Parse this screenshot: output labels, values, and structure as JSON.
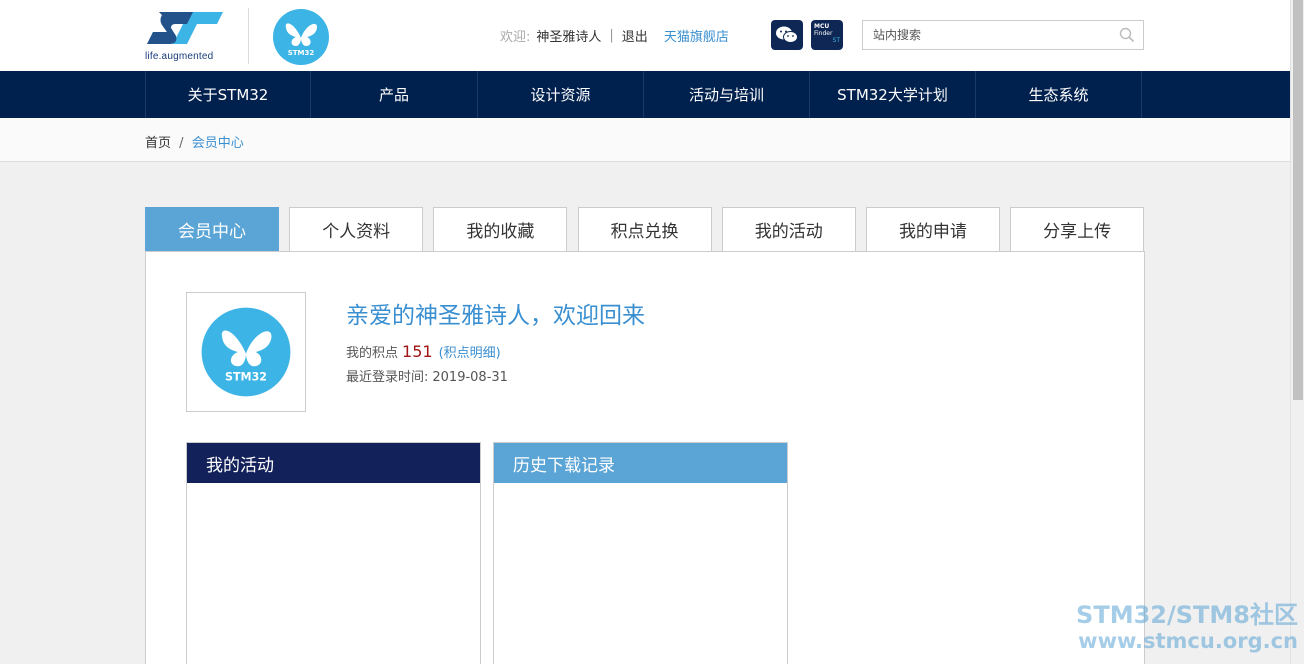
{
  "header": {
    "st_tagline": "life.augmented",
    "stm32_logo_text": "STM32",
    "welcome_label": "欢迎:",
    "username": "神圣雅诗人",
    "separator": "|",
    "logout": "退出",
    "tmall_link": "天猫旗舰店",
    "wechat_icon": "wechat-icon",
    "mcu_finder": {
      "line1": "MCU",
      "line2": "Finder",
      "line3": "ST"
    },
    "search": {
      "placeholder": "站内搜索",
      "icon": "search-icon"
    }
  },
  "nav": {
    "items": [
      "关于STM32",
      "产品",
      "设计资源",
      "活动与培训",
      "STM32大学计划",
      "生态系统"
    ]
  },
  "breadcrumb": {
    "home": "首页",
    "separator": "/",
    "current": "会员中心"
  },
  "tabs": [
    "会员中心",
    "个人资料",
    "我的收藏",
    "积点兑换",
    "我的活动",
    "我的申请",
    "分享上传"
  ],
  "profile": {
    "greeting": "亲爱的神圣雅诗人，欢迎回来",
    "points_label": "我的积点",
    "points_value": "151",
    "points_detail_open": "(",
    "points_detail": "积点明细",
    "points_detail_close": ")",
    "last_login_label": "最近登录时间:",
    "last_login_value": "2019-08-31",
    "avatar_text": "STM32"
  },
  "boxes": {
    "activities_title": "我的活动",
    "downloads_title": "历史下载记录"
  },
  "watermark": {
    "line1": "STM32/STM8社区",
    "line2": "www.stmcu.org.cn"
  },
  "colors": {
    "nav_bg": "#00204d",
    "accent": "#5ba4d6",
    "link": "#3a8fd1",
    "points": "#a01515",
    "dark_box": "#13215a"
  }
}
